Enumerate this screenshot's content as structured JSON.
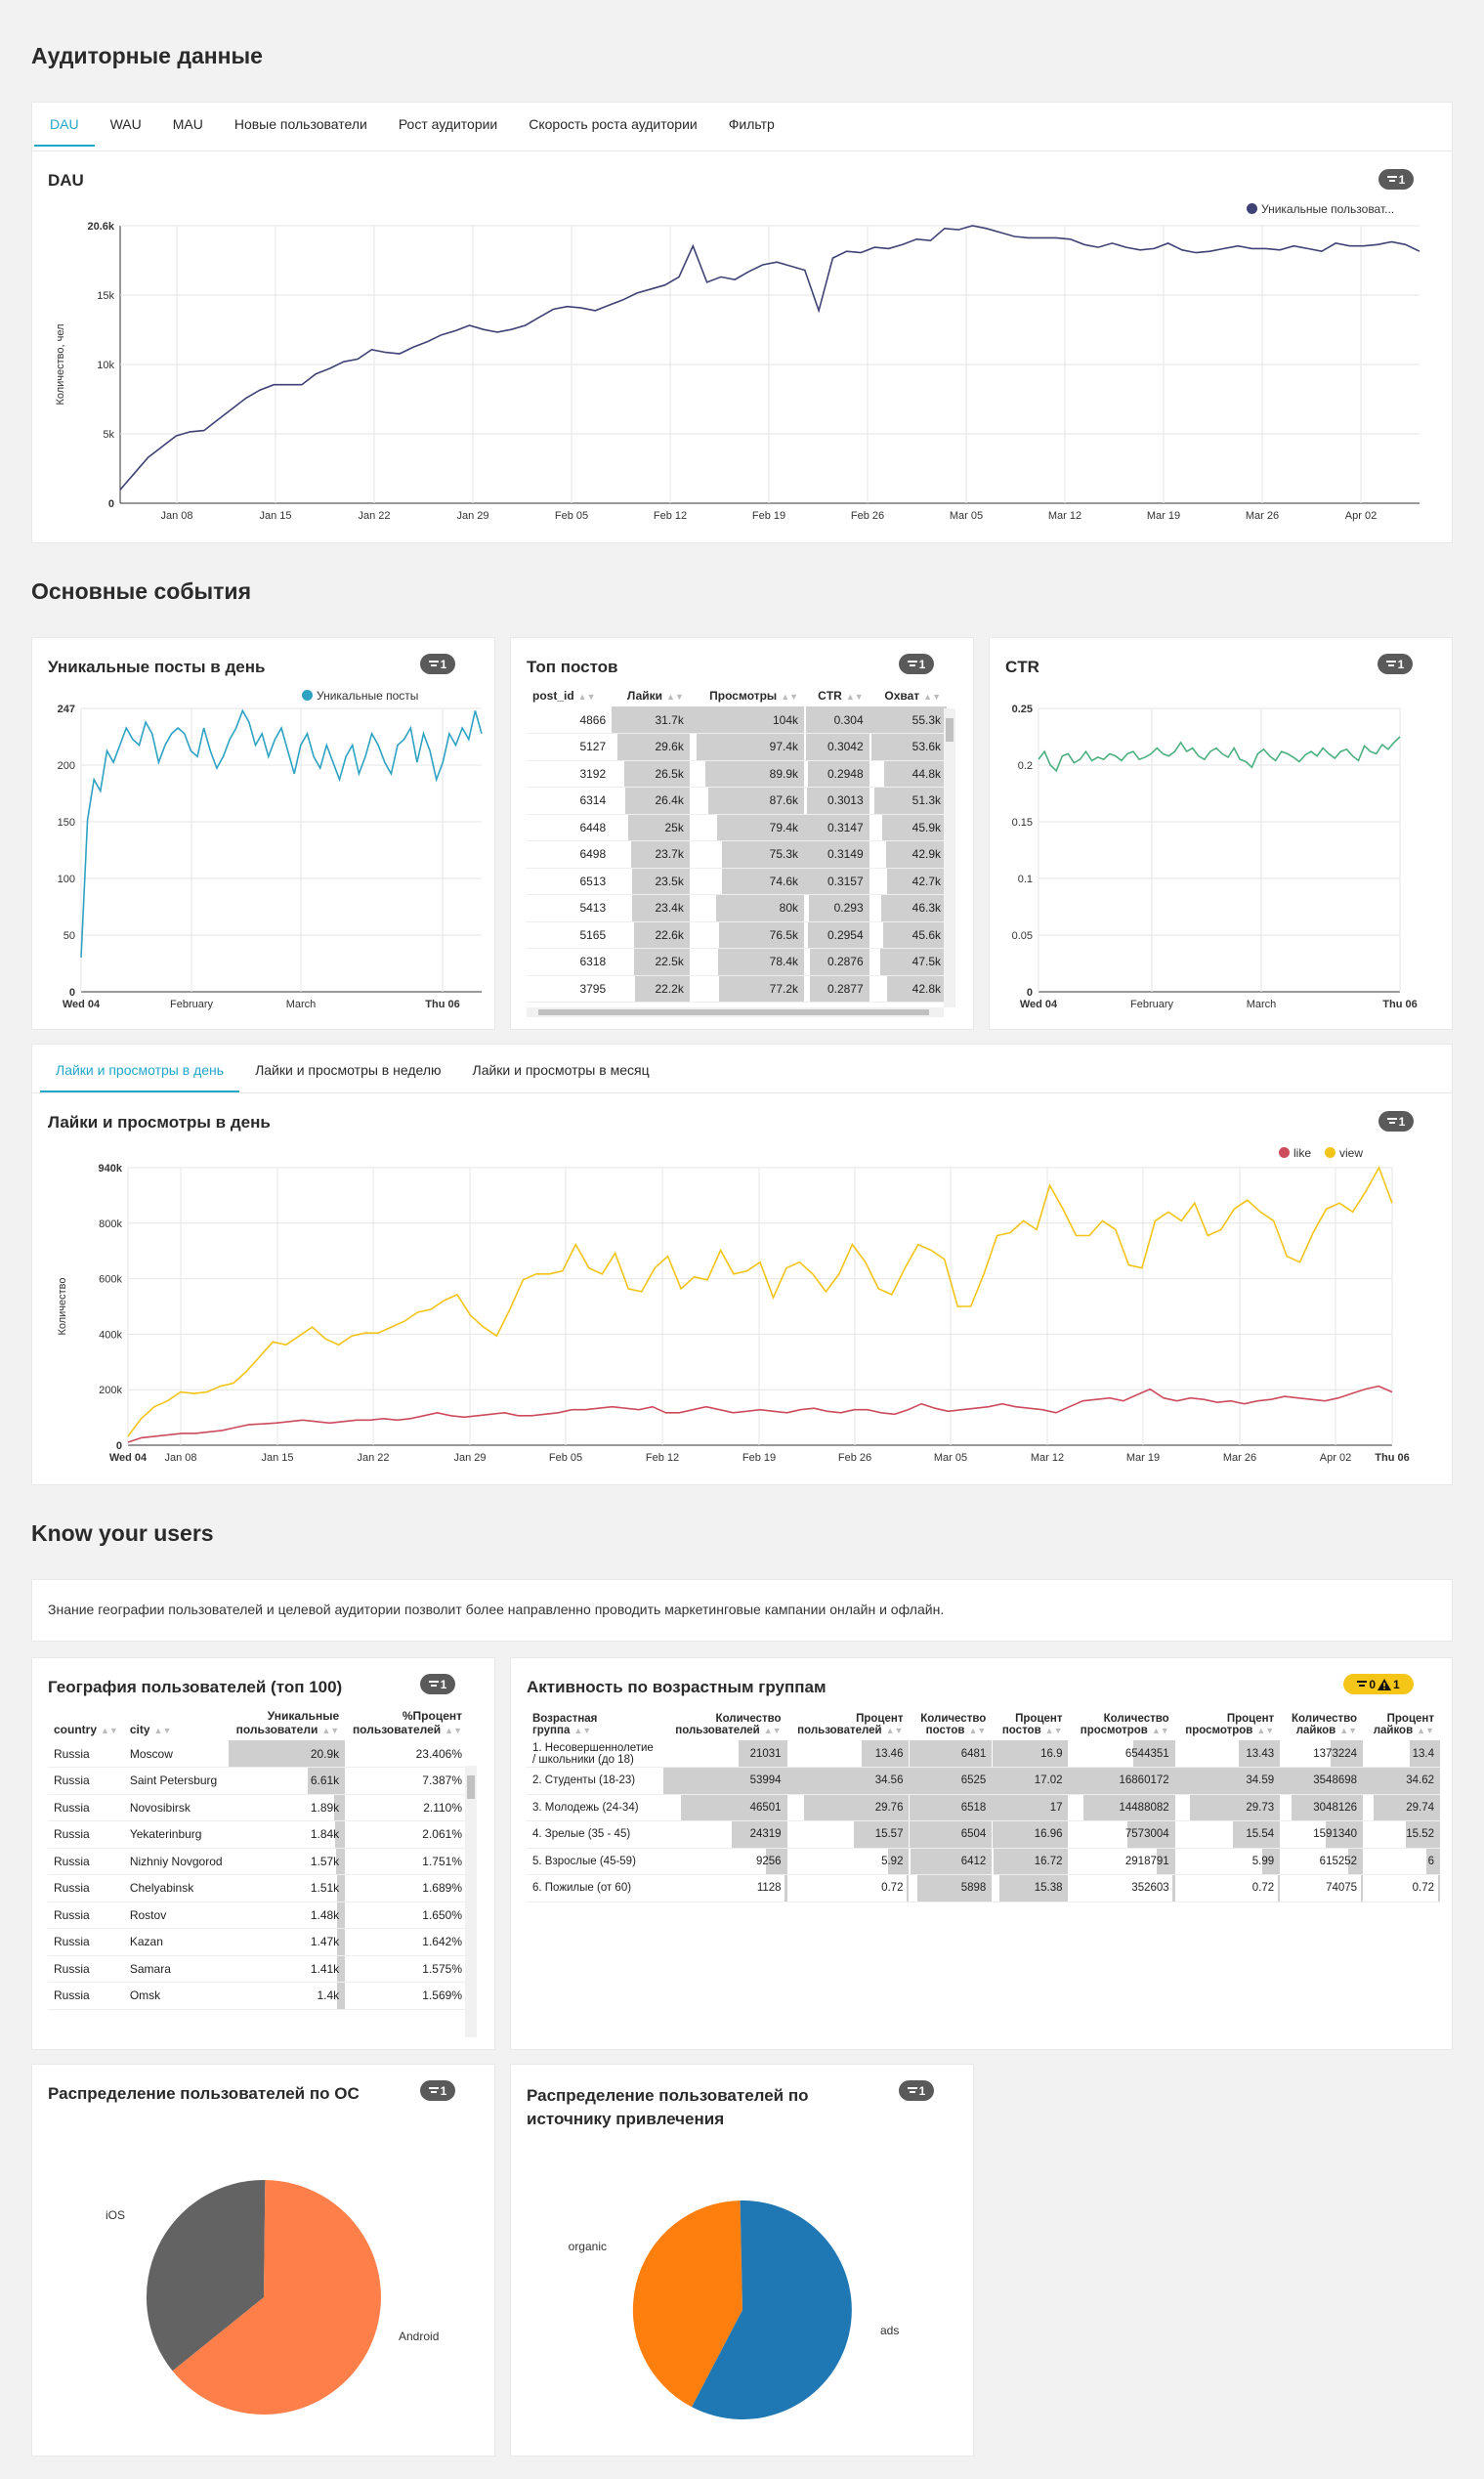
{
  "sections": {
    "audience": "Аудиторные данные",
    "events": "Основные события",
    "know": "Know your users"
  },
  "audience_tabs": [
    "DAU",
    "WAU",
    "MAU",
    "Новые пользователи",
    "Рост аудитории",
    "Скорость роста аудитории",
    "Фильтр"
  ],
  "likes_tabs": [
    "Лайки и просмотры в день",
    "Лайки и просмотры в неделю",
    "Лайки и просмотры в месяц"
  ],
  "badges": {
    "filter_count": "1",
    "warn_count": "0",
    "alert_count": "1"
  },
  "dau": {
    "title": "DAU",
    "legend": "Уникальные пользоват...",
    "ylabel": "Количество, чел",
    "color": "#3f4274"
  },
  "posts": {
    "title": "Уникальные посты в день",
    "legend": "Уникальные посты",
    "color": "#2ea2c2"
  },
  "top": {
    "title": "Топ постов",
    "headers": [
      "post_id",
      "Лайки",
      "Просмотры",
      "CTR",
      "Охват"
    ],
    "rows": [
      [
        "4866",
        "31.7k",
        "104k",
        "0.304",
        "55.3k"
      ],
      [
        "5127",
        "29.6k",
        "97.4k",
        "0.3042",
        "53.6k"
      ],
      [
        "3192",
        "26.5k",
        "89.9k",
        "0.2948",
        "44.8k"
      ],
      [
        "6314",
        "26.4k",
        "87.6k",
        "0.3013",
        "51.3k"
      ],
      [
        "6448",
        "25k",
        "79.4k",
        "0.3147",
        "45.9k"
      ],
      [
        "6498",
        "23.7k",
        "75.3k",
        "0.3149",
        "42.9k"
      ],
      [
        "6513",
        "23.5k",
        "74.6k",
        "0.3157",
        "42.7k"
      ],
      [
        "5413",
        "23.4k",
        "80k",
        "0.293",
        "46.3k"
      ],
      [
        "5165",
        "22.6k",
        "76.5k",
        "0.2954",
        "45.6k"
      ],
      [
        "6318",
        "22.5k",
        "78.4k",
        "0.2876",
        "47.5k"
      ],
      [
        "3795",
        "22.2k",
        "77.2k",
        "0.2877",
        "42.8k"
      ]
    ],
    "fills": [
      [
        1.0,
        1.0,
        0.97,
        1.0
      ],
      [
        0.93,
        0.94,
        0.97,
        0.97
      ],
      [
        0.84,
        0.86,
        0.94,
        0.81
      ],
      [
        0.83,
        0.84,
        0.96,
        0.93
      ],
      [
        0.79,
        0.76,
        1.0,
        0.83
      ],
      [
        0.75,
        0.72,
        1.0,
        0.78
      ],
      [
        0.74,
        0.72,
        1.0,
        0.77
      ],
      [
        0.74,
        0.77,
        0.93,
        0.84
      ],
      [
        0.71,
        0.74,
        0.94,
        0.82
      ],
      [
        0.71,
        0.75,
        0.91,
        0.86
      ],
      [
        0.7,
        0.74,
        0.91,
        0.77
      ]
    ]
  },
  "ctr": {
    "title": "CTR",
    "color": "#4caf80"
  },
  "likes": {
    "title": "Лайки и просмотры в день",
    "ylabel": "Количество",
    "like_label": "like",
    "view_label": "view",
    "like_color": "#cc4b5d",
    "view_color": "#f2c418"
  },
  "know_text": "Знание географии пользователей и целевой аудитории позволит более направленно проводить маркетинговые кампании онлайн и офлайн.",
  "geo": {
    "title": "География пользователей (топ 100)",
    "headers": [
      "country",
      "city",
      "Уникальные пользователи",
      "%Процент пользователей"
    ],
    "rows": [
      [
        "Russia",
        "Moscow",
        "20.9k",
        "23.406%",
        1.0
      ],
      [
        "Russia",
        "Saint Petersburg",
        "6.61k",
        "7.387%",
        0.316
      ],
      [
        "Russia",
        "Novosibirsk",
        "1.89k",
        "2.110%",
        0.09
      ],
      [
        "Russia",
        "Yekaterinburg",
        "1.84k",
        "2.061%",
        0.088
      ],
      [
        "Russia",
        "Nizhniy Novgorod",
        "1.57k",
        "1.751%",
        0.075
      ],
      [
        "Russia",
        "Chelyabinsk",
        "1.51k",
        "1.689%",
        0.072
      ],
      [
        "Russia",
        "Rostov",
        "1.48k",
        "1.650%",
        0.071
      ],
      [
        "Russia",
        "Kazan",
        "1.47k",
        "1.642%",
        0.07
      ],
      [
        "Russia",
        "Samara",
        "1.41k",
        "1.575%",
        0.067
      ],
      [
        "Russia",
        "Omsk",
        "1.4k",
        "1.569%",
        0.067
      ]
    ]
  },
  "age": {
    "title": "Активность по возрастным группам",
    "headers": [
      "Возрастная группа",
      "Количество пользователей",
      "Процент пользователей",
      "Количество постов",
      "Процент постов",
      "Количество просмотров",
      "Процент просмотров",
      "Количество лайков",
      "Процент лайков"
    ],
    "rows": [
      [
        "1. Несовершеннолетие / школьники (до 18)",
        "21031",
        "13.46",
        "6481",
        "16.9",
        "6544351",
        "13.43",
        "1373224",
        "13.4"
      ],
      [
        "2. Студенты (18-23)",
        "53994",
        "34.56",
        "6525",
        "17.02",
        "16860172",
        "34.59",
        "3548698",
        "34.62"
      ],
      [
        "3. Молодежь (24-34)",
        "46501",
        "29.76",
        "6518",
        "17",
        "14488082",
        "29.73",
        "3048126",
        "29.74"
      ],
      [
        "4. Зрелые (35 - 45)",
        "24319",
        "15.57",
        "6504",
        "16.96",
        "7573004",
        "15.54",
        "1591340",
        "15.52"
      ],
      [
        "5. Взрослые (45-59)",
        "9256",
        "5.92",
        "6412",
        "16.72",
        "2918791",
        "5.99",
        "615252",
        "6"
      ],
      [
        "6. Пожилые (от 60)",
        "1128",
        "0.72",
        "5898",
        "15.38",
        "352603",
        "0.72",
        "74075",
        "0.72"
      ]
    ],
    "fills": [
      [
        0.389,
        0.389,
        0.993,
        0.993,
        0.388,
        0.388,
        0.387,
        0.387
      ],
      [
        1.0,
        1.0,
        1.0,
        1.0,
        1.0,
        1.0,
        1.0,
        1.0
      ],
      [
        0.861,
        0.861,
        0.999,
        0.999,
        0.859,
        0.859,
        0.859,
        0.859
      ],
      [
        0.45,
        0.45,
        0.997,
        0.997,
        0.449,
        0.449,
        0.448,
        0.448
      ],
      [
        0.171,
        0.171,
        0.983,
        0.983,
        0.173,
        0.173,
        0.173,
        0.173
      ],
      [
        0.021,
        0.021,
        0.904,
        0.904,
        0.021,
        0.021,
        0.021,
        0.021
      ]
    ]
  },
  "os": {
    "title": "Распределение пользователей по ОС",
    "labels": [
      "iOS",
      "Android"
    ],
    "colors": [
      "#636363",
      "#ff7f4a"
    ],
    "values": [
      0.36,
      0.64
    ]
  },
  "source": {
    "title": "Распределение пользователей по источнику привлечения",
    "labels": [
      "organic",
      "ads"
    ],
    "colors": [
      "#ff7f0e",
      "#1f77b4"
    ],
    "values": [
      0.42,
      0.58
    ]
  },
  "chart_data": [
    {
      "type": "line",
      "title": "DAU",
      "ylabel": "Количество, чел",
      "x": [
        "Jan 03",
        "Jan 04",
        "Jan 05",
        "Jan 06",
        "Jan 07",
        "Jan 08",
        "Jan 09",
        "Jan 10",
        "Jan 11",
        "Jan 12",
        "Jan 13",
        "Jan 14",
        "Jan 15",
        "Jan 16",
        "Jan 17",
        "Jan 18",
        "Jan 19",
        "Jan 20",
        "Jan 21",
        "Jan 22",
        "Jan 23",
        "Jan 24",
        "Jan 25",
        "Jan 26",
        "Jan 27",
        "Jan 28",
        "Jan 29",
        "Jan 30",
        "Jan 31",
        "Feb 01",
        "Feb 02",
        "Feb 03",
        "Feb 04",
        "Feb 05",
        "Feb 06",
        "Feb 07",
        "Feb 08",
        "Feb 09",
        "Feb 10",
        "Feb 11",
        "Feb 12",
        "Feb 13",
        "Feb 14",
        "Feb 15",
        "Feb 16",
        "Feb 17",
        "Feb 18",
        "Feb 19",
        "Feb 20",
        "Feb 21",
        "Feb 22",
        "Feb 23",
        "Feb 24",
        "Feb 25",
        "Feb 26",
        "Feb 27",
        "Feb 28",
        "Mar 01",
        "Mar 02",
        "Mar 03",
        "Mar 04",
        "Mar 05",
        "Mar 06",
        "Mar 07",
        "Mar 08",
        "Mar 09",
        "Mar 10",
        "Mar 11",
        "Mar 12",
        "Mar 13",
        "Mar 14",
        "Mar 15",
        "Mar 16",
        "Mar 17",
        "Mar 18",
        "Mar 19",
        "Mar 20",
        "Mar 21",
        "Mar 22",
        "Mar 23",
        "Mar 24",
        "Mar 25",
        "Mar 26",
        "Mar 27",
        "Mar 28",
        "Mar 29",
        "Mar 30",
        "Mar 31",
        "Apr 01",
        "Apr 02",
        "Apr 03",
        "Apr 04",
        "Apr 05",
        "Apr 06"
      ],
      "series": [
        {
          "name": "Уникальные пользоват...",
          "values": [
            1000,
            2200,
            3400,
            4200,
            5000,
            5300,
            5400,
            6200,
            7000,
            7800,
            8400,
            8800,
            8800,
            8800,
            9600,
            10000,
            10500,
            10700,
            11400,
            11200,
            11100,
            11600,
            12000,
            12500,
            12800,
            13200,
            12900,
            12700,
            12900,
            13200,
            13800,
            14400,
            14600,
            14500,
            14300,
            14700,
            15100,
            15600,
            15900,
            16200,
            16800,
            19100,
            16400,
            16800,
            16600,
            17200,
            17700,
            17900,
            17600,
            17300,
            14300,
            18200,
            18700,
            18600,
            19000,
            18900,
            19200,
            19600,
            19500,
            20400,
            20300,
            20600,
            20400,
            20100,
            19800,
            19700,
            19700,
            19700,
            19600,
            19200,
            19000,
            19300,
            19000,
            18800,
            18900,
            19300,
            18800,
            18600,
            18700,
            18900,
            19100,
            18900,
            18900,
            18800,
            19100,
            18900,
            18700,
            19300,
            19100,
            19100,
            19200,
            19400,
            19200,
            18700
          ]
        }
      ],
      "ylim": [
        0,
        20600
      ],
      "y_ticks": [
        "0",
        "5k",
        "10k",
        "15k",
        "20.6k"
      ],
      "x_ticks": [
        "Jan 08",
        "Jan 15",
        "Jan 22",
        "Jan 29",
        "Feb 05",
        "Feb 12",
        "Feb 19",
        "Feb 26",
        "Mar 05",
        "Mar 12",
        "Mar 19",
        "Mar 26",
        "Apr 02"
      ]
    },
    {
      "type": "line",
      "title": "Уникальные посты в день",
      "series": [
        {
          "name": "Уникальные посты",
          "values": [
            30,
            150,
            185,
            175,
            210,
            200,
            215,
            230,
            220,
            215,
            235,
            225,
            200,
            215,
            225,
            230,
            225,
            210,
            205,
            230,
            210,
            195,
            205,
            220,
            230,
            245,
            235,
            215,
            225,
            205,
            220,
            230,
            210,
            190,
            215,
            225,
            205,
            195,
            215,
            200,
            185,
            205,
            215,
            190,
            205,
            225,
            215,
            200,
            190,
            215,
            220,
            230,
            200,
            225,
            210,
            185,
            200,
            225,
            215,
            230,
            220,
            245,
            225
          ]
        }
      ],
      "ylim": [
        0,
        247
      ],
      "y_ticks": [
        "0",
        "50",
        "100",
        "150",
        "200",
        "247"
      ],
      "x_ticks": [
        "Wed 04",
        "February",
        "March",
        "Thu 06"
      ]
    },
    {
      "type": "line",
      "title": "CTR",
      "series": [
        {
          "name": "CTR",
          "values": [
            0.205,
            0.212,
            0.2,
            0.195,
            0.208,
            0.21,
            0.202,
            0.205,
            0.212,
            0.204,
            0.207,
            0.205,
            0.21,
            0.208,
            0.204,
            0.21,
            0.212,
            0.205,
            0.207,
            0.21,
            0.215,
            0.21,
            0.208,
            0.212,
            0.22,
            0.212,
            0.215,
            0.208,
            0.205,
            0.212,
            0.215,
            0.21,
            0.207,
            0.215,
            0.205,
            0.203,
            0.198,
            0.21,
            0.214,
            0.208,
            0.204,
            0.212,
            0.21,
            0.207,
            0.203,
            0.209,
            0.212,
            0.208,
            0.215,
            0.21,
            0.206,
            0.212,
            0.214,
            0.208,
            0.204,
            0.217,
            0.212,
            0.21,
            0.218,
            0.214,
            0.22,
            0.225
          ]
        }
      ],
      "ylim": [
        0,
        0.25
      ],
      "y_ticks": [
        "0",
        "0.05",
        "0.1",
        "0.15",
        "0.2",
        "0.25"
      ],
      "x_ticks": [
        "Wed 04",
        "February",
        "March",
        "Thu 06"
      ]
    },
    {
      "type": "line",
      "title": "Лайки и просмотры в день",
      "ylabel": "Количество",
      "series": [
        {
          "name": "like",
          "values": [
            10000,
            25000,
            30000,
            35000,
            40000,
            40000,
            45000,
            50000,
            60000,
            70000,
            72000,
            75000,
            80000,
            85000,
            80000,
            75000,
            80000,
            85000,
            85000,
            90000,
            85000,
            90000,
            100000,
            110000,
            100000,
            95000,
            100000,
            105000,
            110000,
            100000,
            100000,
            105000,
            110000,
            120000,
            120000,
            125000,
            130000,
            125000,
            120000,
            130000,
            110000,
            110000,
            120000,
            130000,
            120000,
            110000,
            115000,
            120000,
            115000,
            110000,
            120000,
            125000,
            115000,
            110000,
            120000,
            120000,
            110000,
            105000,
            120000,
            140000,
            125000,
            115000,
            120000,
            125000,
            130000,
            140000,
            130000,
            125000,
            120000,
            110000,
            130000,
            150000,
            155000,
            160000,
            150000,
            170000,
            190000,
            160000,
            150000,
            160000,
            155000,
            145000,
            150000,
            140000,
            150000,
            155000,
            165000,
            160000,
            155000,
            150000,
            160000,
            175000,
            190000,
            200000,
            180000
          ]
        },
        {
          "name": "view",
          "values": [
            30000,
            90000,
            130000,
            150000,
            180000,
            175000,
            180000,
            200000,
            210000,
            250000,
            300000,
            350000,
            340000,
            370000,
            400000,
            360000,
            340000,
            370000,
            380000,
            380000,
            400000,
            420000,
            450000,
            460000,
            490000,
            510000,
            440000,
            400000,
            370000,
            460000,
            560000,
            580000,
            580000,
            590000,
            680000,
            600000,
            580000,
            650000,
            530000,
            520000,
            600000,
            640000,
            530000,
            570000,
            560000,
            660000,
            580000,
            590000,
            620000,
            500000,
            600000,
            620000,
            580000,
            520000,
            580000,
            680000,
            620000,
            530000,
            510000,
            600000,
            680000,
            660000,
            630000,
            470000,
            470000,
            580000,
            710000,
            720000,
            760000,
            730000,
            880000,
            800000,
            710000,
            710000,
            760000,
            730000,
            610000,
            600000,
            760000,
            790000,
            760000,
            820000,
            710000,
            730000,
            800000,
            830000,
            790000,
            760000,
            640000,
            620000,
            720000,
            800000,
            820000,
            790000,
            860000,
            940000,
            820000
          ]
        }
      ],
      "ylim": [
        0,
        940000
      ],
      "y_ticks": [
        "0",
        "200k",
        "400k",
        "600k",
        "800k",
        "940k"
      ],
      "x_ticks": [
        "Wed 04",
        "Jan 08",
        "Jan 15",
        "Jan 22",
        "Jan 29",
        "Feb 05",
        "Feb 12",
        "Feb 19",
        "Feb 26",
        "Mar 05",
        "Mar 12",
        "Mar 19",
        "Mar 26",
        "Apr 02",
        "Thu 06"
      ]
    },
    {
      "type": "pie",
      "title": "Распределение пользователей по ОС",
      "categories": [
        "iOS",
        "Android"
      ],
      "values": [
        0.36,
        0.64
      ]
    },
    {
      "type": "pie",
      "title": "Распределение пользователей по источнику привлечения",
      "categories": [
        "organic",
        "ads"
      ],
      "values": [
        0.42,
        0.58
      ]
    }
  ]
}
